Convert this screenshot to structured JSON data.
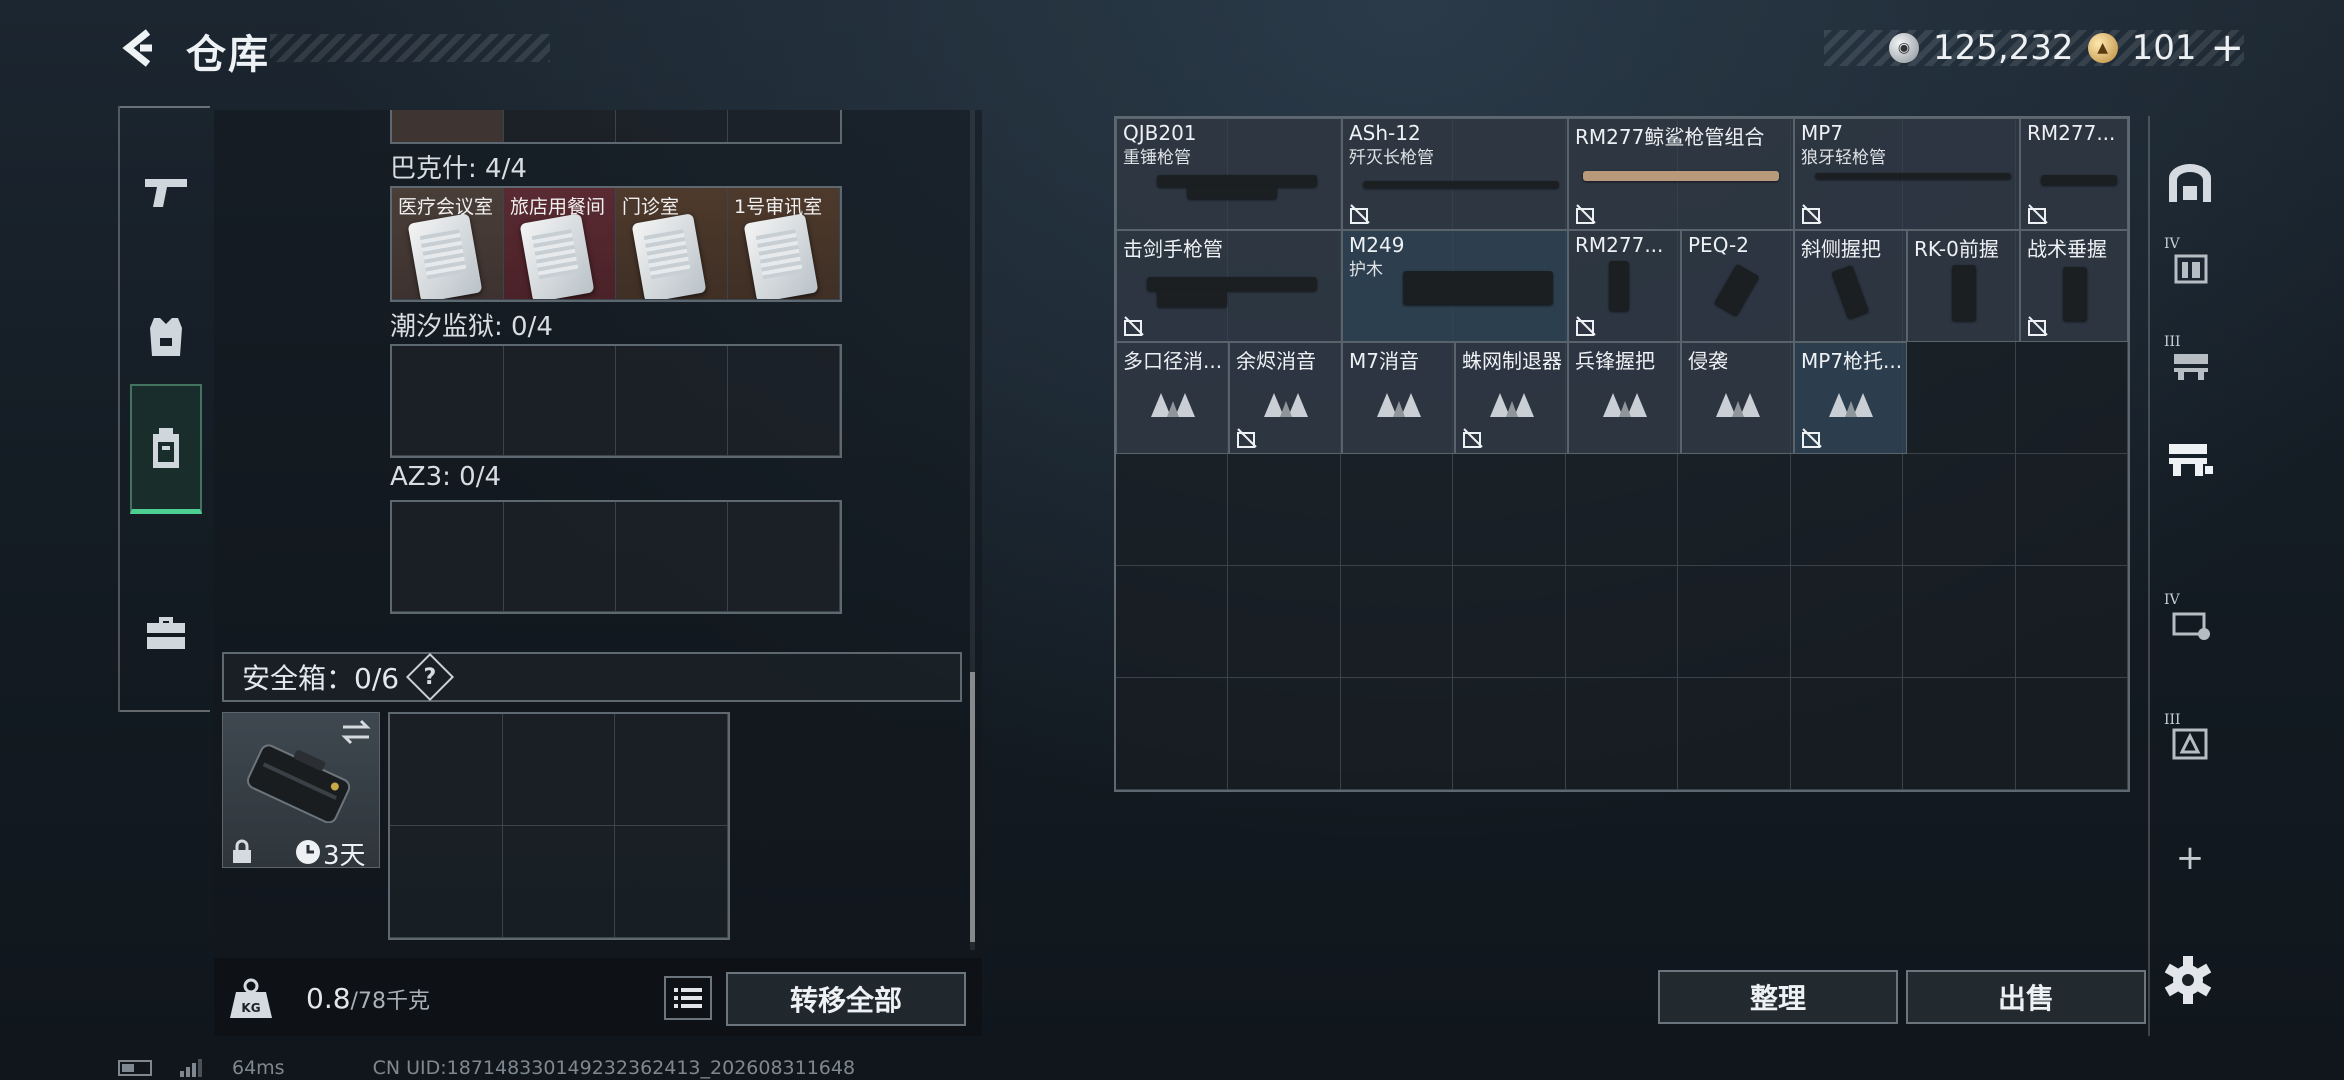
{
  "header": {
    "title": "仓库",
    "currency": [
      {
        "icon": "silver-coin-icon",
        "value": "125,232"
      },
      {
        "icon": "gold-coin-icon",
        "value": "101"
      }
    ],
    "add_label": "+"
  },
  "left_nav": {
    "tabs": [
      {
        "icon": "pistol-icon",
        "active": false
      },
      {
        "icon": "vest-icon",
        "active": false
      },
      {
        "icon": "backpack-icon",
        "active": true
      },
      {
        "icon": "briefcase-icon",
        "active": false
      }
    ]
  },
  "left_panel": {
    "sections": [
      {
        "label": "巴克什: 4/4",
        "keys": [
          "医疗会议室",
          "旅店用餐间",
          "门诊室",
          "1号审讯室"
        ]
      },
      {
        "label": "潮汐监狱: 0/4"
      },
      {
        "label": "AZ3: 0/4"
      }
    ],
    "safe_box": {
      "label": "安全箱：0/6",
      "help": "?",
      "timer": "3天"
    },
    "weight": {
      "current": "0.8",
      "max": "/78",
      "unit": "千克"
    },
    "transfer_all": "转移全部"
  },
  "storage": {
    "items": [
      {
        "name": "QJB201",
        "sub": "重锤枪管"
      },
      {
        "name": "ASh-12",
        "sub": "歼灭长枪管"
      },
      {
        "name": "RM277鲸鲨枪管组合",
        "sub": ""
      },
      {
        "name": "MP7",
        "sub": "狼牙轻枪管"
      },
      {
        "name": "RM277...",
        "sub": ""
      },
      {
        "name": "击剑手枪管",
        "sub": ""
      },
      {
        "name": "M249",
        "sub": "护木"
      },
      {
        "name": "RM277...",
        "sub": ""
      },
      {
        "name": "PEQ-2",
        "sub": ""
      },
      {
        "name": "斜侧握把",
        "sub": ""
      },
      {
        "name": "RK-0前握",
        "sub": ""
      },
      {
        "name": "战术垂握",
        "sub": ""
      },
      {
        "name": "多口径消...",
        "sub": ""
      },
      {
        "name": "余烬消音",
        "sub": ""
      },
      {
        "name": "M7消音",
        "sub": ""
      },
      {
        "name": "蛛网制退器",
        "sub": ""
      },
      {
        "name": "兵锋握把",
        "sub": ""
      },
      {
        "name": "侵袭",
        "sub": ""
      },
      {
        "name": "MP7枪托...",
        "sub": ""
      }
    ]
  },
  "right_nav": {
    "tabs": [
      {
        "icon": "shelf-icon",
        "level": ""
      },
      {
        "icon": "storage-iv-icon",
        "level": "IV"
      },
      {
        "icon": "storage-iii-icon",
        "level": "III"
      },
      {
        "icon": "storage-active-icon",
        "level": ""
      },
      {
        "icon": "storage-iv-lock-icon",
        "level": "IV"
      },
      {
        "icon": "storage-iii-warn-icon",
        "level": "III"
      }
    ],
    "add": "+"
  },
  "actions": {
    "sort": "整理",
    "sell": "出售"
  },
  "status": {
    "ping": "64ms",
    "uid": "CN UID:18714833014923236​2413_202608311648"
  },
  "colors": {
    "accent": "#4ecf92",
    "panel": "#141c24"
  }
}
